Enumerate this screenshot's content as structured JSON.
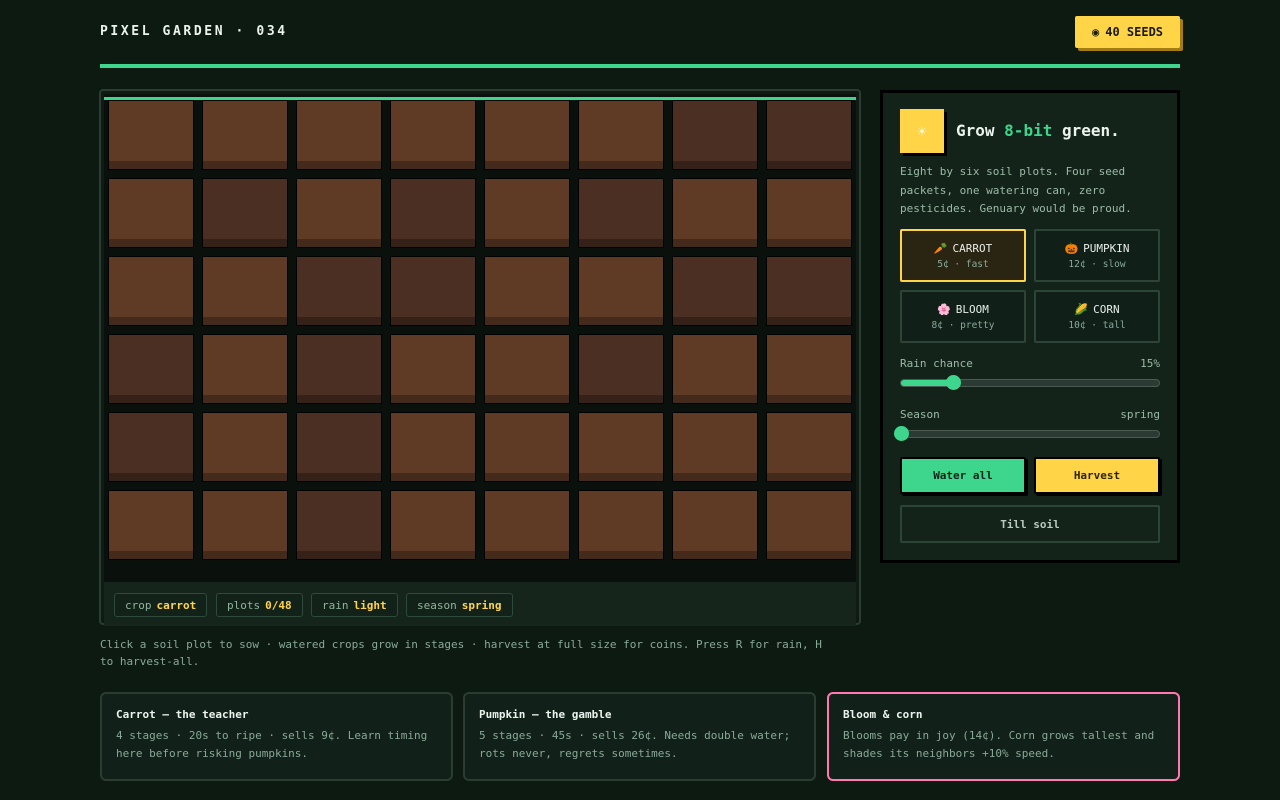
{
  "header": {
    "title": "PIXEL GARDEN · 034",
    "seeds_icon": "◉",
    "seeds_label": "40 SEEDS"
  },
  "board": {
    "plots": [
      [
        "light",
        "light",
        "light",
        "light",
        "light",
        "light",
        "dark",
        "dark"
      ],
      [
        "light",
        "dark",
        "light",
        "dark",
        "light",
        "dark",
        "light",
        "light"
      ],
      [
        "light",
        "light",
        "dark",
        "dark",
        "light",
        "light",
        "dark",
        "dark"
      ],
      [
        "dark",
        "light",
        "dark",
        "light",
        "light",
        "dark",
        "light",
        "light"
      ],
      [
        "dark",
        "light",
        "dark",
        "light",
        "light",
        "light",
        "light",
        "light"
      ],
      [
        "light",
        "light",
        "dark",
        "light",
        "light",
        "light",
        "light",
        "light"
      ]
    ],
    "status": {
      "crop_key": "crop",
      "crop_val": "carrot",
      "plots_key": "plots",
      "plots_val": "0/48",
      "rain_key": "rain",
      "rain_val": "light",
      "season_key": "season",
      "season_val": "spring"
    }
  },
  "hint": "Click a soil plot to sow · watered crops grow in stages · harvest at full size for coins. Press R for rain, H to harvest-all.",
  "panel": {
    "icon": "☀",
    "title_prefix": "Grow ",
    "title_accent": "8-bit",
    "title_suffix": " green.",
    "description": "Eight by six soil plots. Four seed packets, one watering can, zero pesticides. Genuary would be proud.",
    "crops": [
      {
        "icon": "🥕",
        "name": "CARROT",
        "meta": "5¢ · fast",
        "selected": true
      },
      {
        "icon": "🎃",
        "name": "PUMPKIN",
        "meta": "12¢ · slow",
        "selected": false
      },
      {
        "icon": "🌸",
        "name": "BLOOM",
        "meta": "8¢ · pretty",
        "selected": false
      },
      {
        "icon": "🌽",
        "name": "CORN",
        "meta": "10¢ · tall",
        "selected": false
      }
    ],
    "rain": {
      "label": "Rain chance",
      "value_text": "15%",
      "level": 0.2
    },
    "season": {
      "label": "Season",
      "value_text": "spring",
      "level": 0.0
    },
    "water_button": "Water all",
    "harvest_button": "Harvest",
    "till_button": "Till soil"
  },
  "cards": [
    {
      "title": "Carrot — the teacher",
      "text": "4 stages · 20s to ripe · sells 9¢. Learn timing here before risking pumpkins."
    },
    {
      "title": "Pumpkin — the gamble",
      "text": "5 stages · 45s · sells 26¢. Needs double water; rots never, regrets sometimes."
    },
    {
      "title": "Bloom & corn",
      "text": "Blooms pay in joy (14¢). Corn grows tallest and shades its neighbors +10% speed."
    }
  ],
  "colors": {
    "accent_green": "#3dd68c",
    "accent_yellow": "#ffd447",
    "accent_pink": "#ff79b0",
    "bg": "#0c1a12"
  }
}
